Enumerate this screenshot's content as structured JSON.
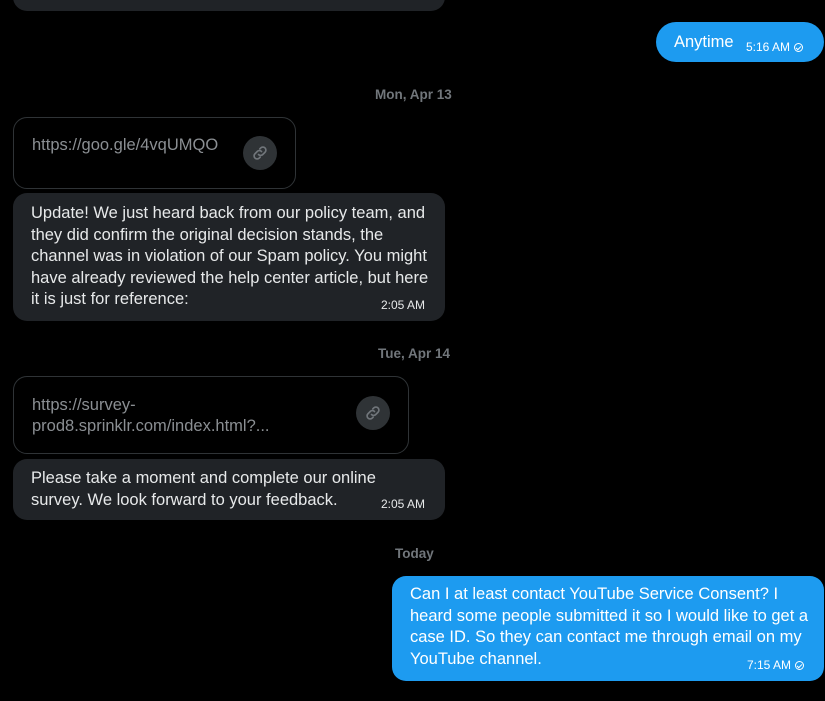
{
  "messages": [
    {
      "direction": "incoming",
      "text": "",
      "time": ""
    },
    {
      "direction": "outgoing",
      "text": "Anytime",
      "time": "5:16 AM"
    },
    {
      "direction": "incoming",
      "text": "Update! We just heard back from our policy team, and they did confirm the original decision stands, the channel was in violation of our Spam policy. You might have already reviewed the help center article, but here it is just for reference:",
      "time": "2:05 AM"
    },
    {
      "direction": "incoming",
      "text": "Please take a moment and complete our online survey. We look forward to your feedback.",
      "time": "2:05 AM"
    },
    {
      "direction": "outgoing",
      "text": "Can I at least contact YouTube Service Consent? I heard some people submitted it so I would like to get a case ID. So they can contact me through email on my YouTube channel.",
      "time": "7:15 AM"
    }
  ],
  "dates": [
    "Mon, Apr 13",
    "Tue, Apr 14",
    "Today"
  ],
  "links": [
    {
      "url": "https://goo.gle/4vqUMQO",
      "icon": "link-icon"
    },
    {
      "url_line1": "https://survey-",
      "url_line2": "prod8.sprinklr.com/index.html?...",
      "icon": "link-icon"
    }
  ],
  "colors": {
    "background": "#000000",
    "incoming_bubble": "#202327",
    "outgoing_bubble": "#1d9bf0",
    "date_text": "#71767b",
    "link_text": "#8b8f93"
  }
}
